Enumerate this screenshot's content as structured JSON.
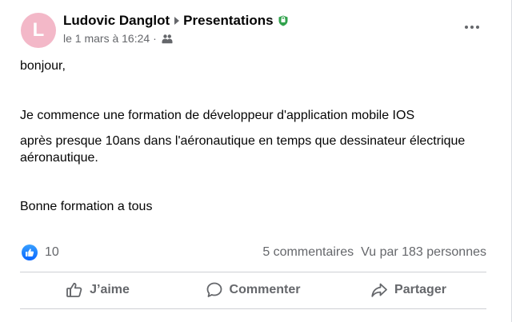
{
  "post": {
    "avatar_letter": "L",
    "author": "Ludovic Danglot",
    "group": "Presentations",
    "timestamp": "le 1 mars à 16:24",
    "separator": "·",
    "paragraphs": [
      "bonjour,",
      "Je commence une formation de développeur d'application mobile IOS",
      "après presque 10ans dans l'aéronautique en temps que dessinateur électrique aéronautique.",
      "Bonne formation a tous"
    ]
  },
  "stats": {
    "likes": "10",
    "comments": "5 commentaires",
    "views": "Vu par 183 personnes"
  },
  "actions": {
    "like": "J’aime",
    "comment": "Commenter",
    "share": "Partager"
  },
  "icons": {
    "more": "more-horizontal-icon",
    "group": "group-icon",
    "shield": "shield-icon",
    "like": "thumbs-up-icon",
    "comment": "comment-bubble-icon",
    "share": "share-arrow-icon"
  },
  "colors": {
    "avatar": "#f3b8c8",
    "like_blue": "#0866ff",
    "shield_green": "#31a24c",
    "secondary_text": "#65676b"
  }
}
